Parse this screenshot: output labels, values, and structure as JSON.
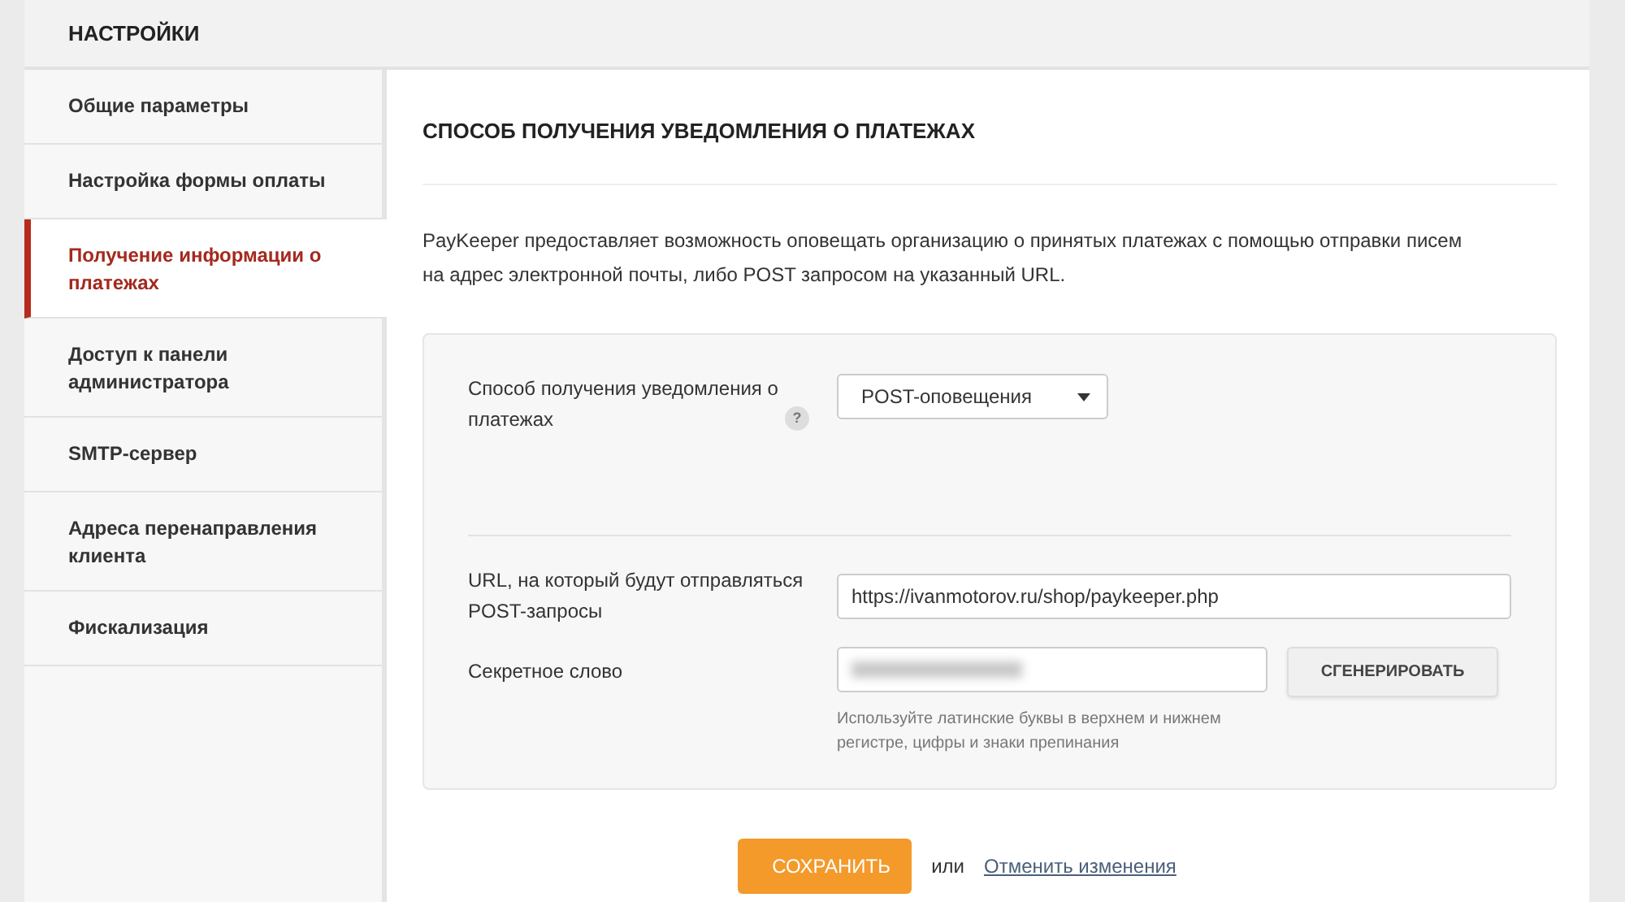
{
  "header": {
    "title": "НАСТРОЙКИ"
  },
  "sidebar": {
    "items": [
      {
        "label": "Общие параметры",
        "selected": false
      },
      {
        "label": "Настройка формы оплаты",
        "selected": false
      },
      {
        "label": "Получение информации о платежах",
        "selected": true
      },
      {
        "label": "Доступ к панели администратора",
        "selected": false
      },
      {
        "label": "SMTP-сервер",
        "selected": false
      },
      {
        "label": "Адреса перенаправления клиента",
        "selected": false
      },
      {
        "label": "Фискализация",
        "selected": false
      }
    ]
  },
  "section": {
    "title": "СПОСОБ ПОЛУЧЕНИЯ УВЕДОМЛЕНИЯ О ПЛАТЕЖАХ",
    "description": "PayKeeper предоставляет возможность оповещать организацию о принятых платежах с помощью отправки писем на адрес электронной почты, либо POST запросом на указанный URL."
  },
  "form": {
    "method": {
      "label": "Способ получения уведомления о платежах",
      "help": "?",
      "value": "POST-оповещения"
    },
    "url": {
      "label": "URL, на который будут отправляться POST-запросы",
      "value": "https://ivanmotorov.ru/shop/paykeeper.php"
    },
    "secret": {
      "label": "Секретное слово",
      "hint": "Используйте латинские буквы в верхнем и нижнем регистре, цифры и знаки препинания",
      "button": "СГЕНЕРИРОВАТЬ"
    }
  },
  "actions": {
    "save": "СОХРАНИТЬ",
    "separator": "или",
    "cancel": "Отменить изменения"
  }
}
